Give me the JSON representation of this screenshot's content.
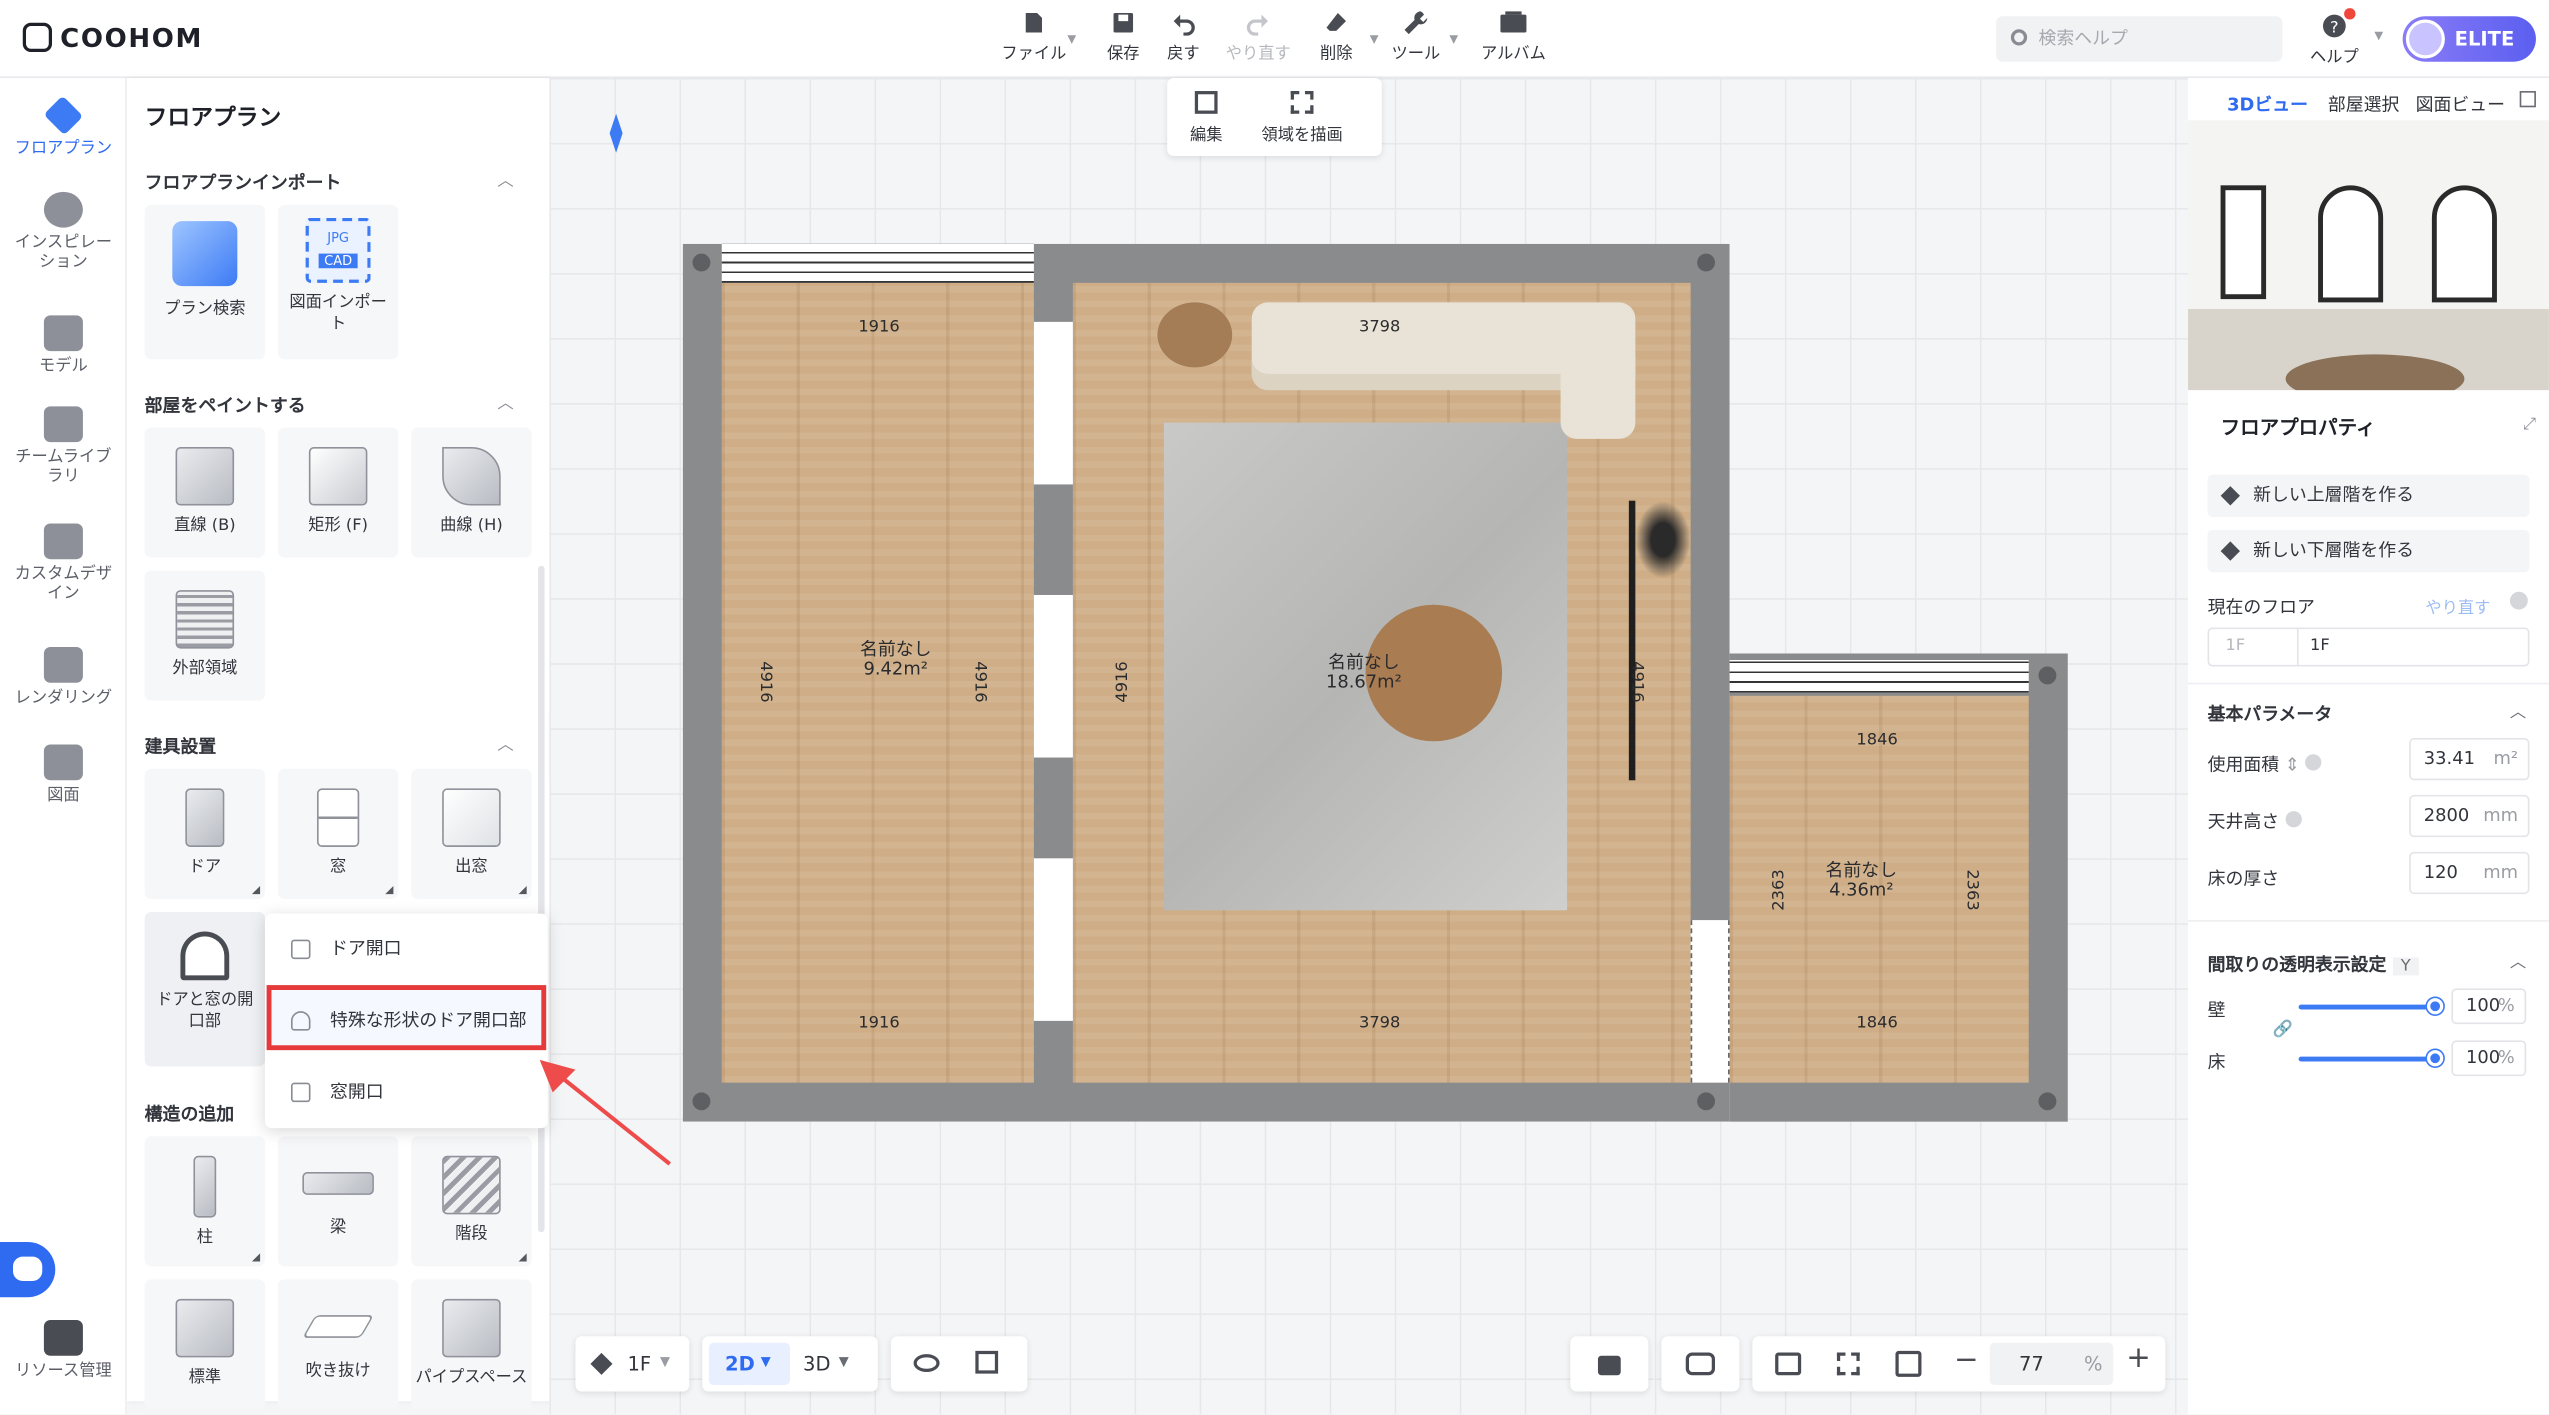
{
  "app": {
    "logo": "COOHOM"
  },
  "toolbar": {
    "file": "ファイル",
    "save": "保存",
    "undo": "戻す",
    "redo": "やり直す",
    "delete": "削除",
    "tools": "ツール",
    "album": "アルバム"
  },
  "header": {
    "search_placeholder": "検索ヘルプ",
    "help": "ヘルプ",
    "plan": "ELITE"
  },
  "rail": [
    "フロアプラン",
    "インスピレーション",
    "モデル",
    "チームライブラリ",
    "カスタムデザイン",
    "レンダリング",
    "図面",
    "リソース管理"
  ],
  "panel": {
    "title": "フロアプラン",
    "import": {
      "header": "フロアプランインポート",
      "items": [
        "プラン検索",
        "図面インポート"
      ],
      "badge": [
        "JPG",
        "CAD"
      ]
    },
    "paint": {
      "header": "部屋をペイントする",
      "items": [
        "直線 (B)",
        "矩形 (F)",
        "曲線 (H)",
        "外部領域"
      ]
    },
    "fixtures": {
      "header": "建具設置",
      "items": [
        "ドア",
        "窓",
        "出窓",
        "ドアと窓の開口部"
      ]
    },
    "structure": {
      "header": "構造の追加",
      "items": [
        "柱",
        "梁",
        "階段",
        "標準",
        "吹き抜け",
        "パイプスペース"
      ]
    }
  },
  "dropdown": {
    "items": [
      "ドア開口",
      "特殊な形状のドア開口部",
      "窓開口"
    ]
  },
  "floating": {
    "edit": "編集",
    "draw_area": "領域を描画"
  },
  "plan": {
    "rooms": [
      {
        "name": "名前なし",
        "area": "9.42m²"
      },
      {
        "name": "名前なし",
        "area": "18.67m²"
      },
      {
        "name": "名前なし",
        "area": "4.36m²"
      }
    ],
    "dims": {
      "a": "1916",
      "b": "3798",
      "c": "1846",
      "v1": "4916",
      "v2": "2363"
    }
  },
  "right": {
    "tabs": [
      "3Dビュー",
      "部屋選択",
      "図面ビュー"
    ],
    "title": "フロアプロパティ",
    "add_upper": "新しい上層階を作る",
    "add_lower": "新しい下層階を作る",
    "current_floor": "現在のフロア",
    "redo": "やり直す",
    "floor_short": "1F",
    "floor_name": "1F",
    "basic": "基本パラメータ",
    "area_label": "使用面積",
    "area_value": "33.41",
    "area_unit": "m²",
    "ceiling_label": "天井高さ",
    "ceiling_value": "2800",
    "mm": "mm",
    "thick_label": "床の厚さ",
    "thick_value": "120",
    "transparency": "間取りの透明表示設定",
    "shortcut": "Y",
    "wall": "壁",
    "floor": "床",
    "wall_pct": "100",
    "floor_pct": "100",
    "pct": "%"
  },
  "bottom": {
    "floor": "1F",
    "mode2d": "2D",
    "mode3d": "3D",
    "zoom": "77",
    "pct": "%"
  }
}
